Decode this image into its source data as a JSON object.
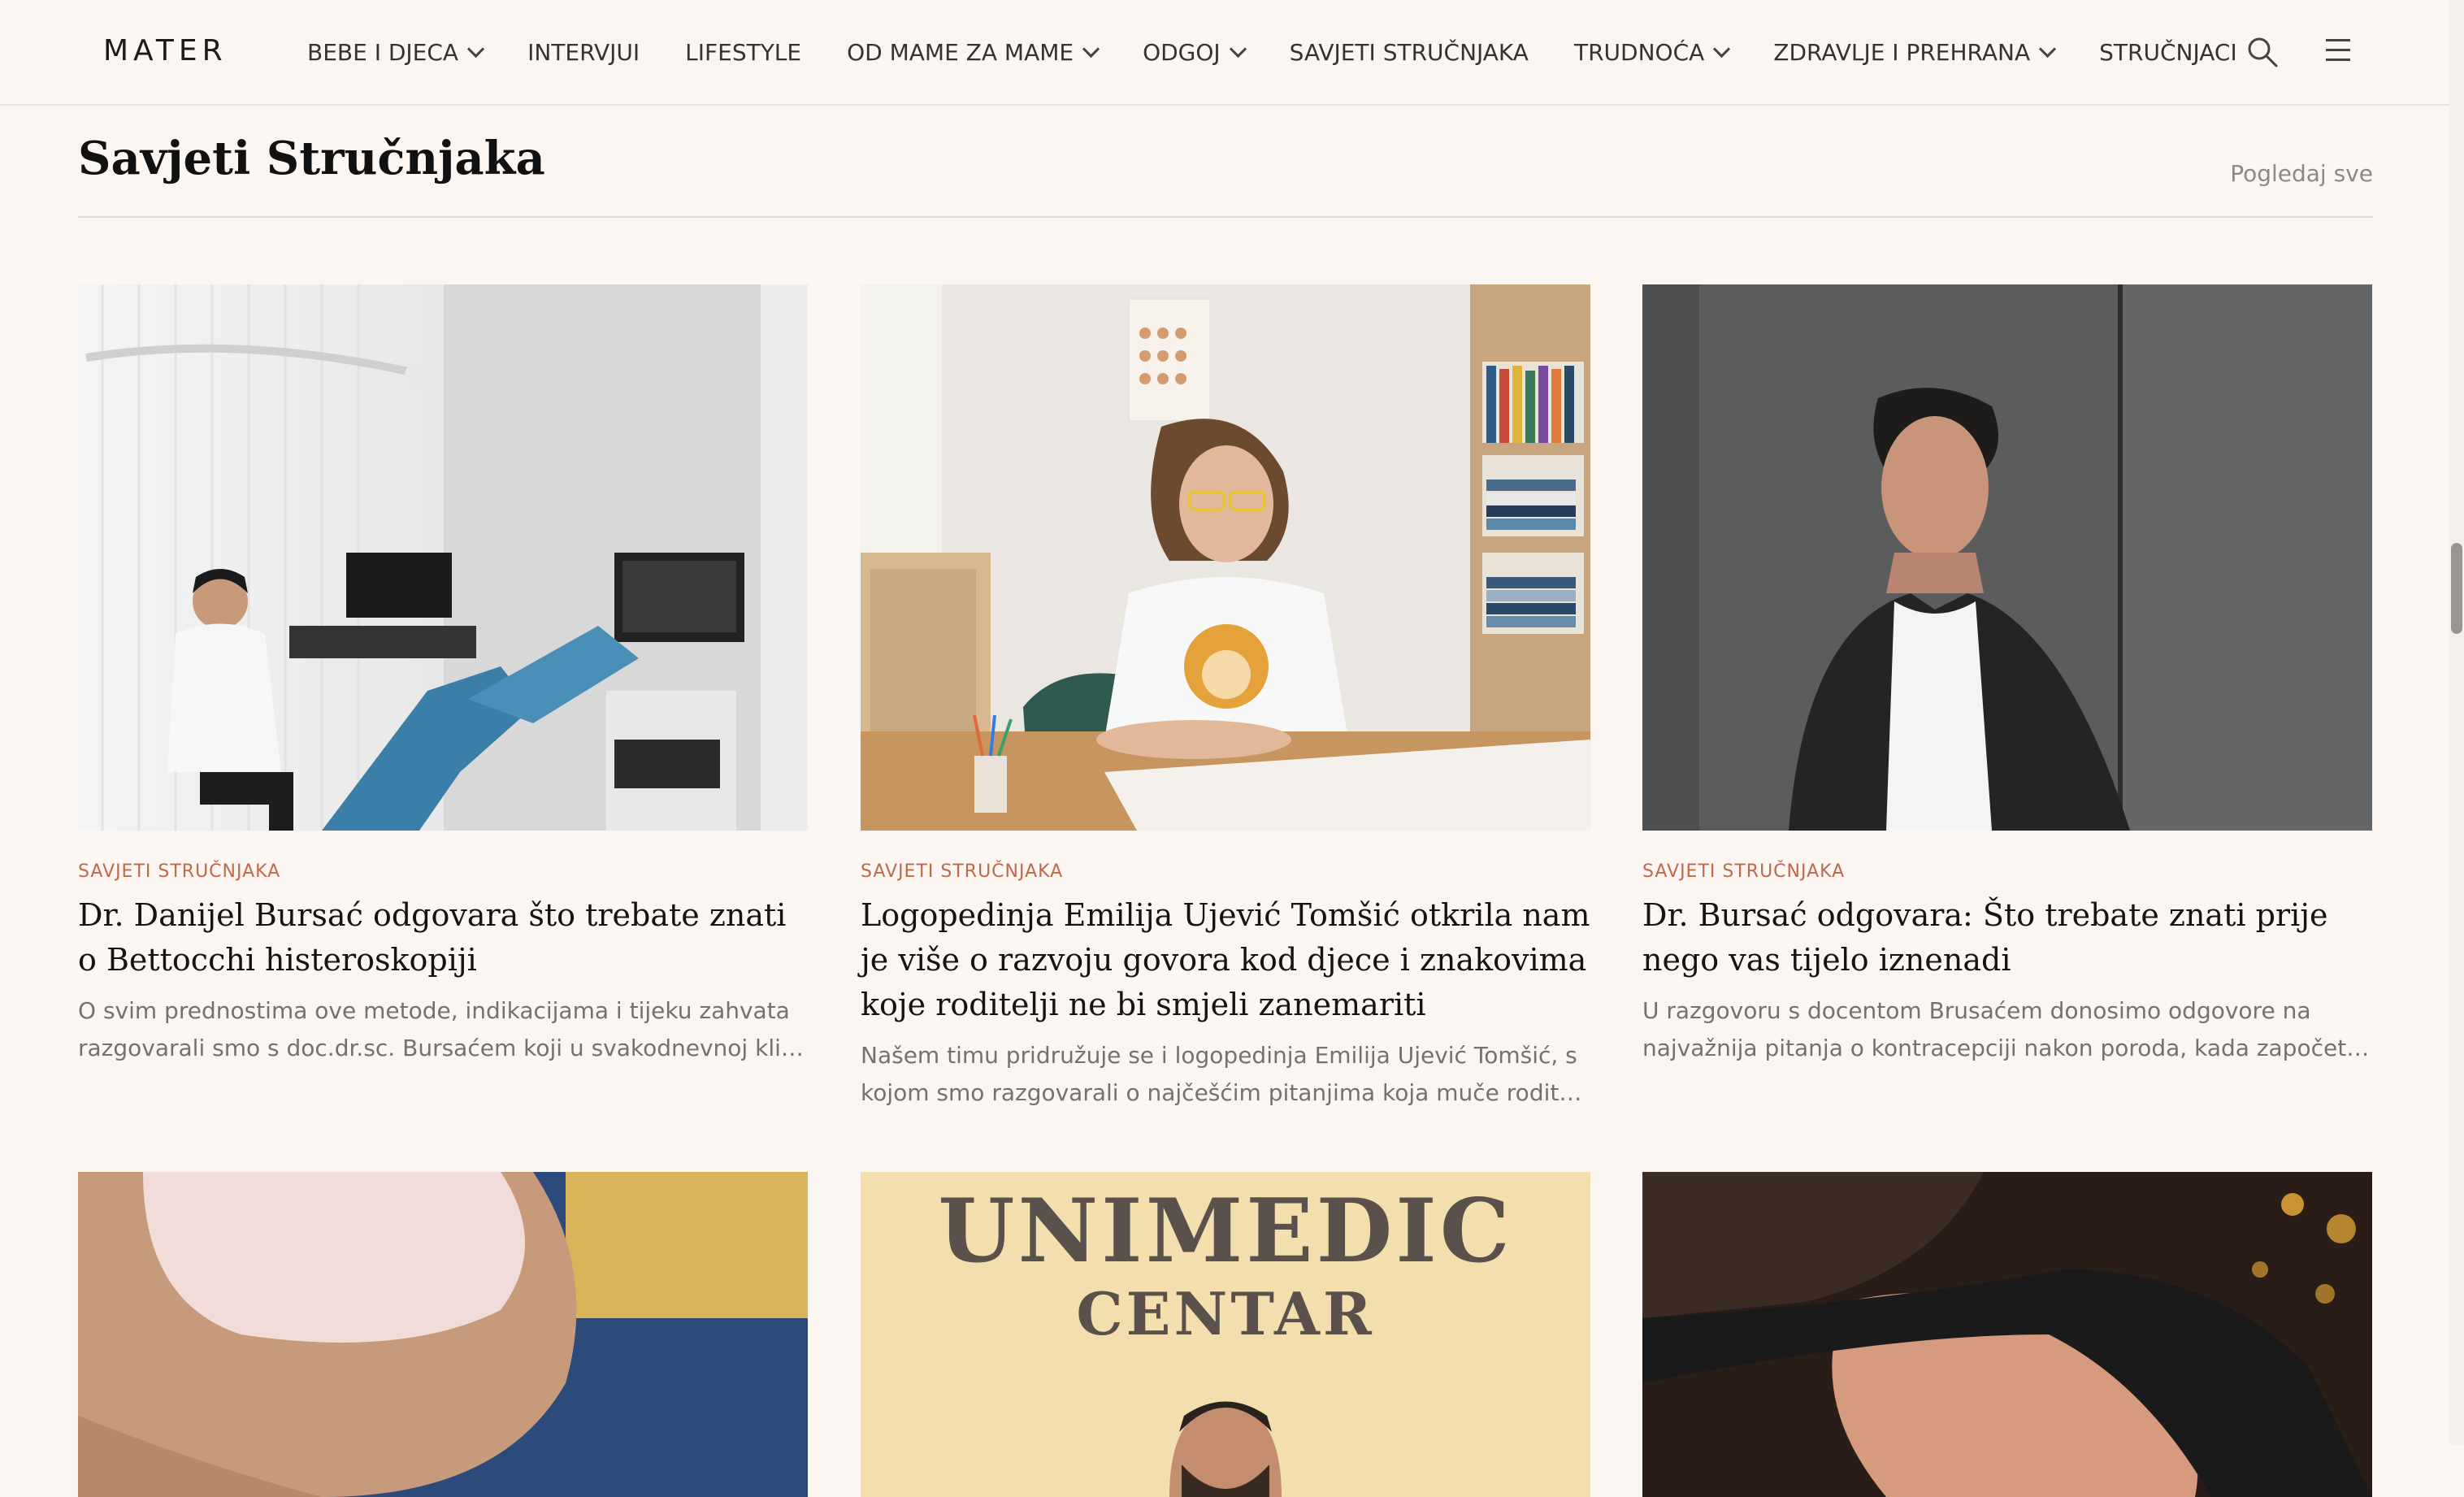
{
  "header": {
    "logo": "MATER",
    "nav": [
      {
        "label": "BEBE I DJECA",
        "dropdown": true
      },
      {
        "label": "INTERVJUI",
        "dropdown": false
      },
      {
        "label": "LIFESTYLE",
        "dropdown": false
      },
      {
        "label": "OD MAME ZA MAME",
        "dropdown": true
      },
      {
        "label": "ODGOJ",
        "dropdown": true
      },
      {
        "label": "SAVJETI STRUČNJAKA",
        "dropdown": false
      },
      {
        "label": "TRUDNOĆA",
        "dropdown": true
      },
      {
        "label": "ZDRAVLJE I PREHRANA",
        "dropdown": true
      },
      {
        "label": "STRUČNJACI",
        "dropdown": false
      }
    ],
    "search_icon": "search-icon",
    "menu_icon": "hamburger-menu-icon"
  },
  "section": {
    "title": "Savjeti Stručnjaka",
    "see_all": "Pogledaj sve"
  },
  "cards": [
    {
      "category": "SAVJETI STRUČNJAKA",
      "title": "Dr. Danijel Bursać odgovara što trebate znati o Bettocchi histeroskopiji",
      "excerpt_lines": [
        "O svim prednostima ove metode, indikacijama i tijeku zahvata",
        "razgovarali smo s doc.dr.sc. Bursaćem koji u svakodnevnoj kliničkoj..."
      ]
    },
    {
      "category": "SAVJETI STRUČNJAKA",
      "title": "Logopedinja Emilija Ujević Tomšić otkrila nam je više o razvoju govora kod djece i znakovima koje roditelji ne bi smjeli zanemariti",
      "excerpt_lines": [
        "Našem timu pridružuje se i logopedinja Emilija Ujević Tomšić, s",
        "kojom smo razgovarali o najčešćim pitanjima koja muče roditelje..."
      ]
    },
    {
      "category": "SAVJETI STRUČNJAKA",
      "title": "Dr. Bursać odgovara: Što trebate znati prije nego vas tijelo iznenadi",
      "excerpt_lines": [
        "U razgovoru s docentom Brusaćem donosimo odgovore na",
        "najvažnija pitanja o kontracepciji nakon poroda, kada započeti..."
      ]
    }
  ],
  "unimedic_sign": {
    "line1": "UNIMEDIC",
    "line2": "CENTAR"
  },
  "colors": {
    "background": "#fbf6f2",
    "category": "#c0684a",
    "muted": "#727272"
  }
}
